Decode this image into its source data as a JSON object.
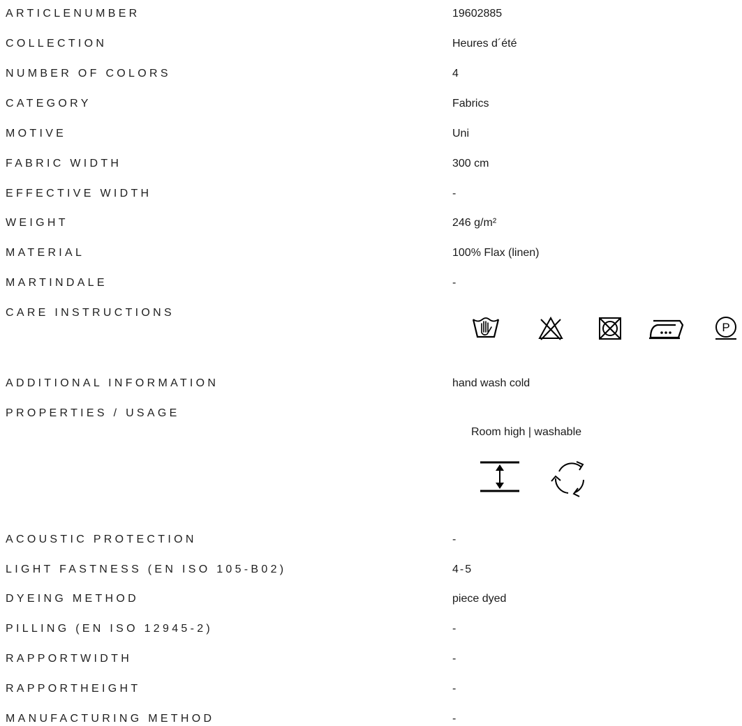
{
  "rows": [
    {
      "label": "ARTICLENUMBER",
      "value": "19602885"
    },
    {
      "label": "COLLECTION",
      "value": "Heures d´été"
    },
    {
      "label": "NUMBER OF COLORS",
      "value": "4"
    },
    {
      "label": "CATEGORY",
      "value": "Fabrics"
    },
    {
      "label": "MOTIVE",
      "value": "Uni"
    },
    {
      "label": "FABRIC WIDTH",
      "value": "300 cm"
    },
    {
      "label": "EFFECTIVE WIDTH",
      "value": "-"
    },
    {
      "label": "WEIGHT",
      "value": "246 g/m²"
    },
    {
      "label": "MATERIAL",
      "value": "100% Flax (linen)"
    },
    {
      "label": "MARTINDALE",
      "value": "-"
    },
    {
      "label": "CARE INSTRUCTIONS",
      "value": ""
    },
    {
      "label": "ADDITIONAL INFORMATION",
      "value": "hand wash cold"
    },
    {
      "label": "PROPERTIES / USAGE",
      "value": "Room high | washable"
    },
    {
      "label": "ACOUSTIC PROTECTION",
      "value": "-"
    },
    {
      "label": "LIGHT FASTNESS (EN ISO 105-B02)",
      "value": "4-5"
    },
    {
      "label": "DYEING METHOD",
      "value": "piece dyed"
    },
    {
      "label": "PILLING (EN ISO 12945-2)",
      "value": "-"
    },
    {
      "label": "RAPPORTWIDTH",
      "value": "-"
    },
    {
      "label": "RAPPORTHEIGHT",
      "value": "-"
    },
    {
      "label": "MANUFACTURING METHOD",
      "value": "-"
    }
  ],
  "care_icons": [
    "hand-wash-icon",
    "do-not-bleach-icon",
    "do-not-tumble-dry-icon",
    "iron-low-heat-icon",
    "professional-dry-clean-p-icon"
  ],
  "care_icon_text": {
    "p_mark": "P"
  },
  "usage_icons": [
    "room-high-icon",
    "washable-cycle-icon"
  ]
}
